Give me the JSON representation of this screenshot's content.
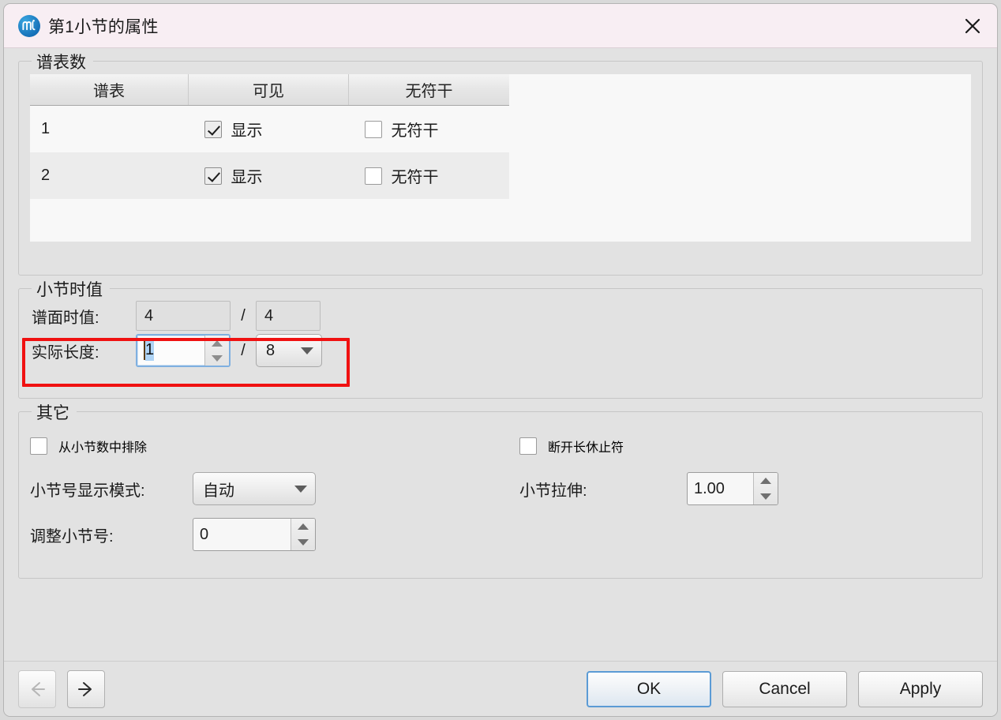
{
  "window": {
    "title": "第1小节的属性",
    "app_icon": "musescore-logo-icon",
    "close_icon": "close-icon",
    "accent": "#5b9bd5",
    "titlebar_color": "#f8eef3",
    "annotation_color": "#f01111"
  },
  "staves_group": {
    "title": "谱表数",
    "columns": [
      "谱表",
      "可见",
      "无符干"
    ],
    "rows": [
      {
        "staff": "1",
        "visible_label": "显示",
        "visible_checked": true,
        "stemless_label": "无符干",
        "stemless_checked": false
      },
      {
        "staff": "2",
        "visible_label": "显示",
        "visible_checked": true,
        "stemless_label": "无符干",
        "stemless_checked": false
      }
    ]
  },
  "duration_group": {
    "title": "小节时值",
    "nominal": {
      "label": "谱面时值:",
      "numerator": "4",
      "separator": "/",
      "denominator": "4"
    },
    "actual": {
      "label": "实际长度:",
      "numerator": "1",
      "separator": "/",
      "denominator": "8"
    }
  },
  "other_group": {
    "title": "其它",
    "exclude_from_count": {
      "label": "从小节数中排除",
      "checked": false
    },
    "break_multimeasure_rest": {
      "label": "断开长休止符",
      "checked": false
    },
    "number_mode": {
      "label": "小节号显示模式:",
      "value": "自动"
    },
    "add_to_number": {
      "label": "调整小节号:",
      "value": "0"
    },
    "stretch": {
      "label": "小节拉伸:",
      "value": "1.00"
    }
  },
  "footer": {
    "prev_icon": "arrow-left-icon",
    "next_icon": "arrow-right-icon",
    "ok": "OK",
    "cancel": "Cancel",
    "apply": "Apply"
  }
}
